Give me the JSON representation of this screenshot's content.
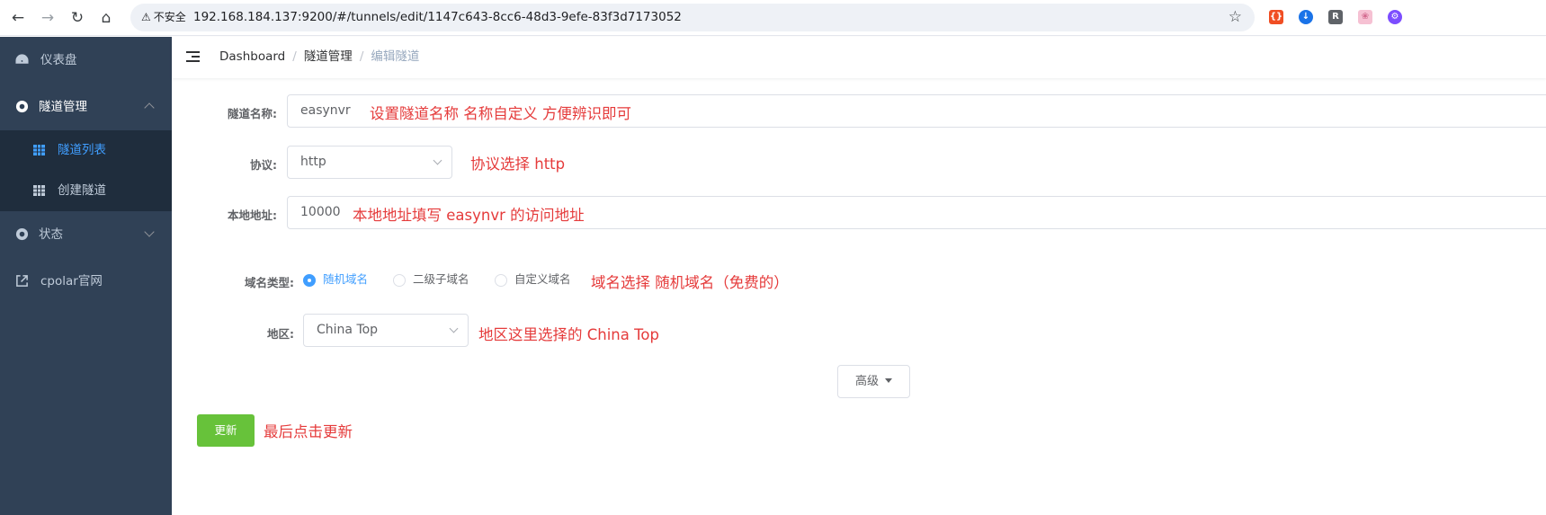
{
  "browser": {
    "url": "192.168.184.137:9200/#/tunnels/edit/1147c643-8cc6-48d3-9efe-83f3d7173052",
    "security_label": "不安全"
  },
  "sidebar": {
    "items": [
      {
        "label": "仪表盘",
        "icon": "dashboard-icon"
      },
      {
        "label": "隧道管理",
        "icon": "tunnel-icon",
        "expanded": true
      },
      {
        "label": "隧道列表",
        "icon": "grid-icon",
        "active": true
      },
      {
        "label": "创建隧道",
        "icon": "grid-icon"
      },
      {
        "label": "状态",
        "icon": "status-icon",
        "expanded": false
      },
      {
        "label": "cpolar官网",
        "icon": "external-link-icon"
      }
    ]
  },
  "breadcrumb": [
    "Dashboard",
    "隧道管理",
    "编辑隧道"
  ],
  "form": {
    "name_label": "隧道名称:",
    "name_value": "easynvr",
    "name_note": "设置隧道名称 名称自定义 方便辨识即可",
    "protocol_label": "协议:",
    "protocol_value": "http",
    "protocol_note": "协议选择 http",
    "local_label": "本地地址:",
    "local_value": "10000",
    "local_note": "本地地址填写 easynvr 的访问地址",
    "domain_type_label": "域名类型:",
    "domain_options": [
      "随机域名",
      "二级子域名",
      "自定义域名"
    ],
    "domain_selected": "随机域名",
    "domain_note": "域名选择 随机域名（免费的）",
    "region_label": "地区:",
    "region_value": "China Top",
    "region_note": "地区这里选择的 China Top",
    "advanced_label": "高级",
    "update_label": "更新",
    "update_note": "最后点击更新"
  },
  "colors": {
    "sidebar_bg": "#304156",
    "submenu_bg": "#1f2d3d",
    "accent": "#409eff",
    "update_button": "#67c23a",
    "annotation": "#e53b3b"
  }
}
